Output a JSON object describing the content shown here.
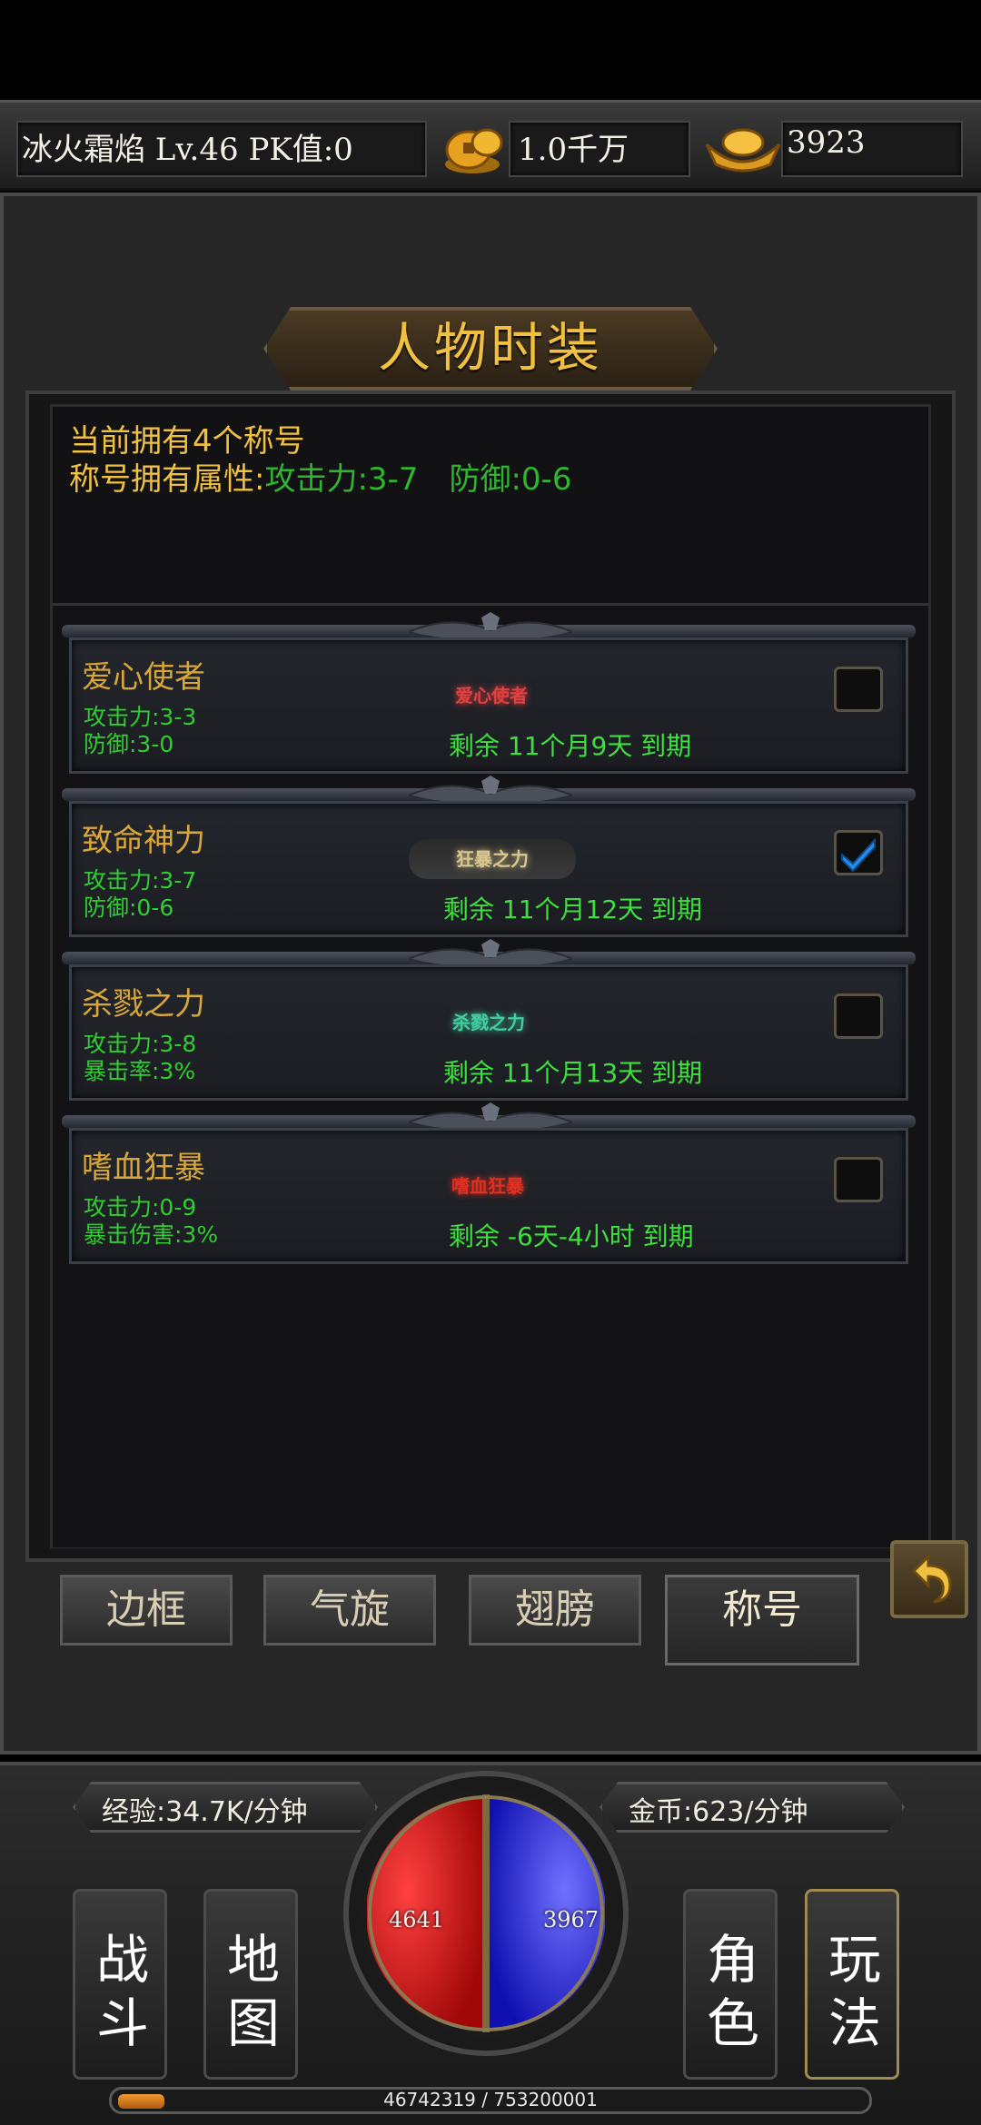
{
  "status_bar": {
    "player": "冰火霜焰  Lv.46 PK值:0",
    "gold": "1.0千万",
    "ingots": "3923"
  },
  "panel": {
    "title": "人物时装",
    "owned_text": "当前拥有4个称号",
    "attr_label": "称号拥有属性:",
    "attr_attack": "攻击力:3-7",
    "attr_defense": "防御:0-6"
  },
  "titles": [
    {
      "name": "爱心使者",
      "stat1": "攻击力:3-3",
      "stat2": "防御:3-0",
      "badge": "爱心使者",
      "badge_color": "#e04040",
      "expire": "剩余 11个月9天 到期",
      "checked": false
    },
    {
      "name": "致命神力",
      "stat1": "攻击力:3-7",
      "stat2": "防御:0-6",
      "badge": "狂暴之力",
      "badge_color": "#d8c890",
      "expire": "剩余 11个月12天 到期",
      "checked": true
    },
    {
      "name": "杀戮之力",
      "stat1": "攻击力:3-8",
      "stat2": "暴击率:3%",
      "badge": "杀戮之力",
      "badge_color": "#40d0a0",
      "expire": "剩余 11个月13天 到期",
      "checked": false
    },
    {
      "name": "嗜血狂暴",
      "stat1": "攻击力:0-9",
      "stat2": "暴击伤害:3%",
      "badge": "嗜血狂暴",
      "badge_color": "#e03020",
      "expire": "剩余 -6天-4小时 到期",
      "checked": false
    }
  ],
  "tabs": [
    {
      "label": "边框",
      "active": false
    },
    {
      "label": "气旋",
      "active": false
    },
    {
      "label": "翅膀",
      "active": false
    },
    {
      "label": "称号",
      "active": true
    }
  ],
  "hud": {
    "exp_rate": "经验:34.7K/分钟",
    "gold_rate": "金币:623/分钟",
    "hp": "4641",
    "mp": "3967",
    "exp_progress": "46742319 / 753200001",
    "exp_fraction": 0.062,
    "menu": {
      "battle": [
        "战",
        "斗"
      ],
      "map": [
        "地",
        "图"
      ],
      "character": [
        "角",
        "色"
      ],
      "gameplay": [
        "玩",
        "法"
      ]
    }
  }
}
